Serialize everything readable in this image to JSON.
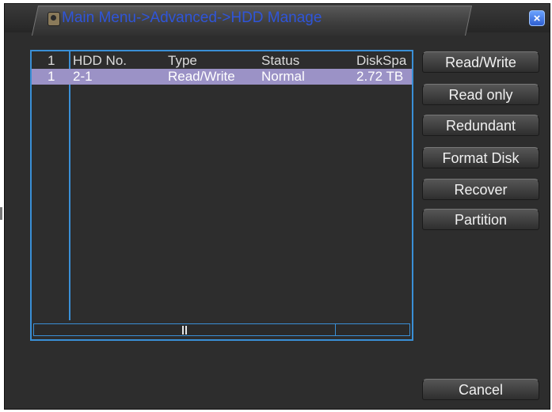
{
  "window": {
    "title": "Main Menu->Advanced->HDD Manage",
    "close_label": "×"
  },
  "table": {
    "columns": [
      "1",
      "HDD No.",
      "Type",
      "Status",
      "DiskSpa"
    ],
    "rows": [
      {
        "index": "1",
        "hdd_no": "2-1",
        "type": "Read/Write",
        "status": "Normal",
        "disk_space": "2.72 TB",
        "selected": true
      }
    ]
  },
  "actions": {
    "read_write": "Read/Write",
    "read_only": "Read only",
    "redundant": "Redundant",
    "format_disk": "Format Disk",
    "recover": "Recover",
    "partition": "Partition",
    "cancel": "Cancel"
  },
  "colors": {
    "title_text": "#2f55d9",
    "table_border": "#3a8fd6",
    "selected_row": "#9b92c6"
  }
}
